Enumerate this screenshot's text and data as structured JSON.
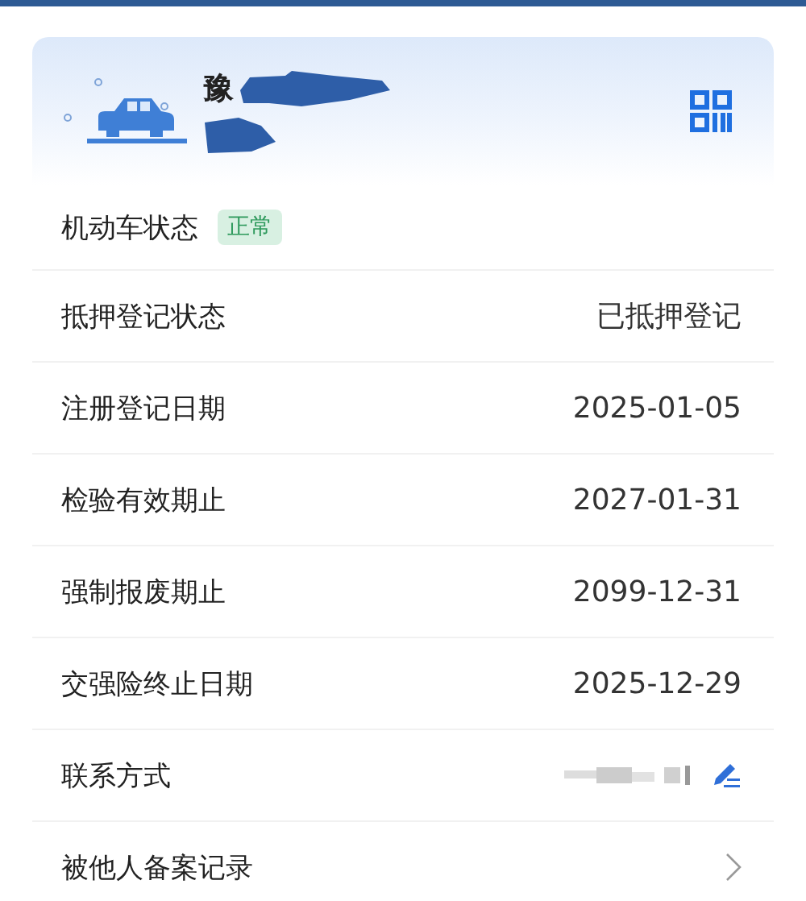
{
  "vehicle": {
    "plate_prefix": "豫"
  },
  "status": {
    "label": "机动车状态",
    "badge": "正常"
  },
  "rows": [
    {
      "kind": "value",
      "label": "抵押登记状态",
      "value": "已抵押登记"
    },
    {
      "kind": "value",
      "label": "注册登记日期",
      "value": "2025-01-05"
    },
    {
      "kind": "value",
      "label": "检验有效期止",
      "value": "2027-01-31"
    },
    {
      "kind": "value",
      "label": "强制报废期止",
      "value": "2099-12-31"
    },
    {
      "kind": "value",
      "label": "交强险终止日期",
      "value": "2025-12-29"
    },
    {
      "kind": "contact",
      "label": "联系方式"
    },
    {
      "kind": "link",
      "label": "被他人备案记录"
    }
  ]
}
